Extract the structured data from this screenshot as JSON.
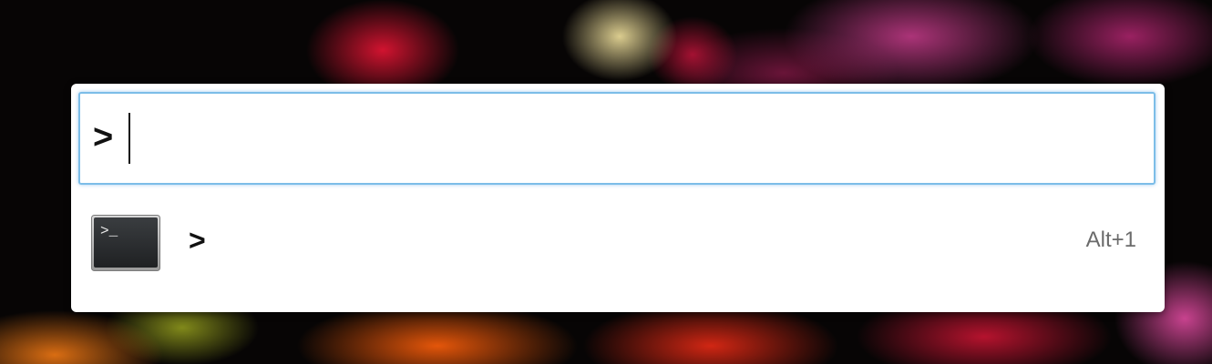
{
  "launcher": {
    "prompt_symbol": ">",
    "query_value": "",
    "focus_color": "#7cbde8"
  },
  "results": [
    {
      "icon": "terminal-icon",
      "icon_glyph": ">_",
      "title": ">",
      "shortcut": "Alt+1"
    }
  ]
}
